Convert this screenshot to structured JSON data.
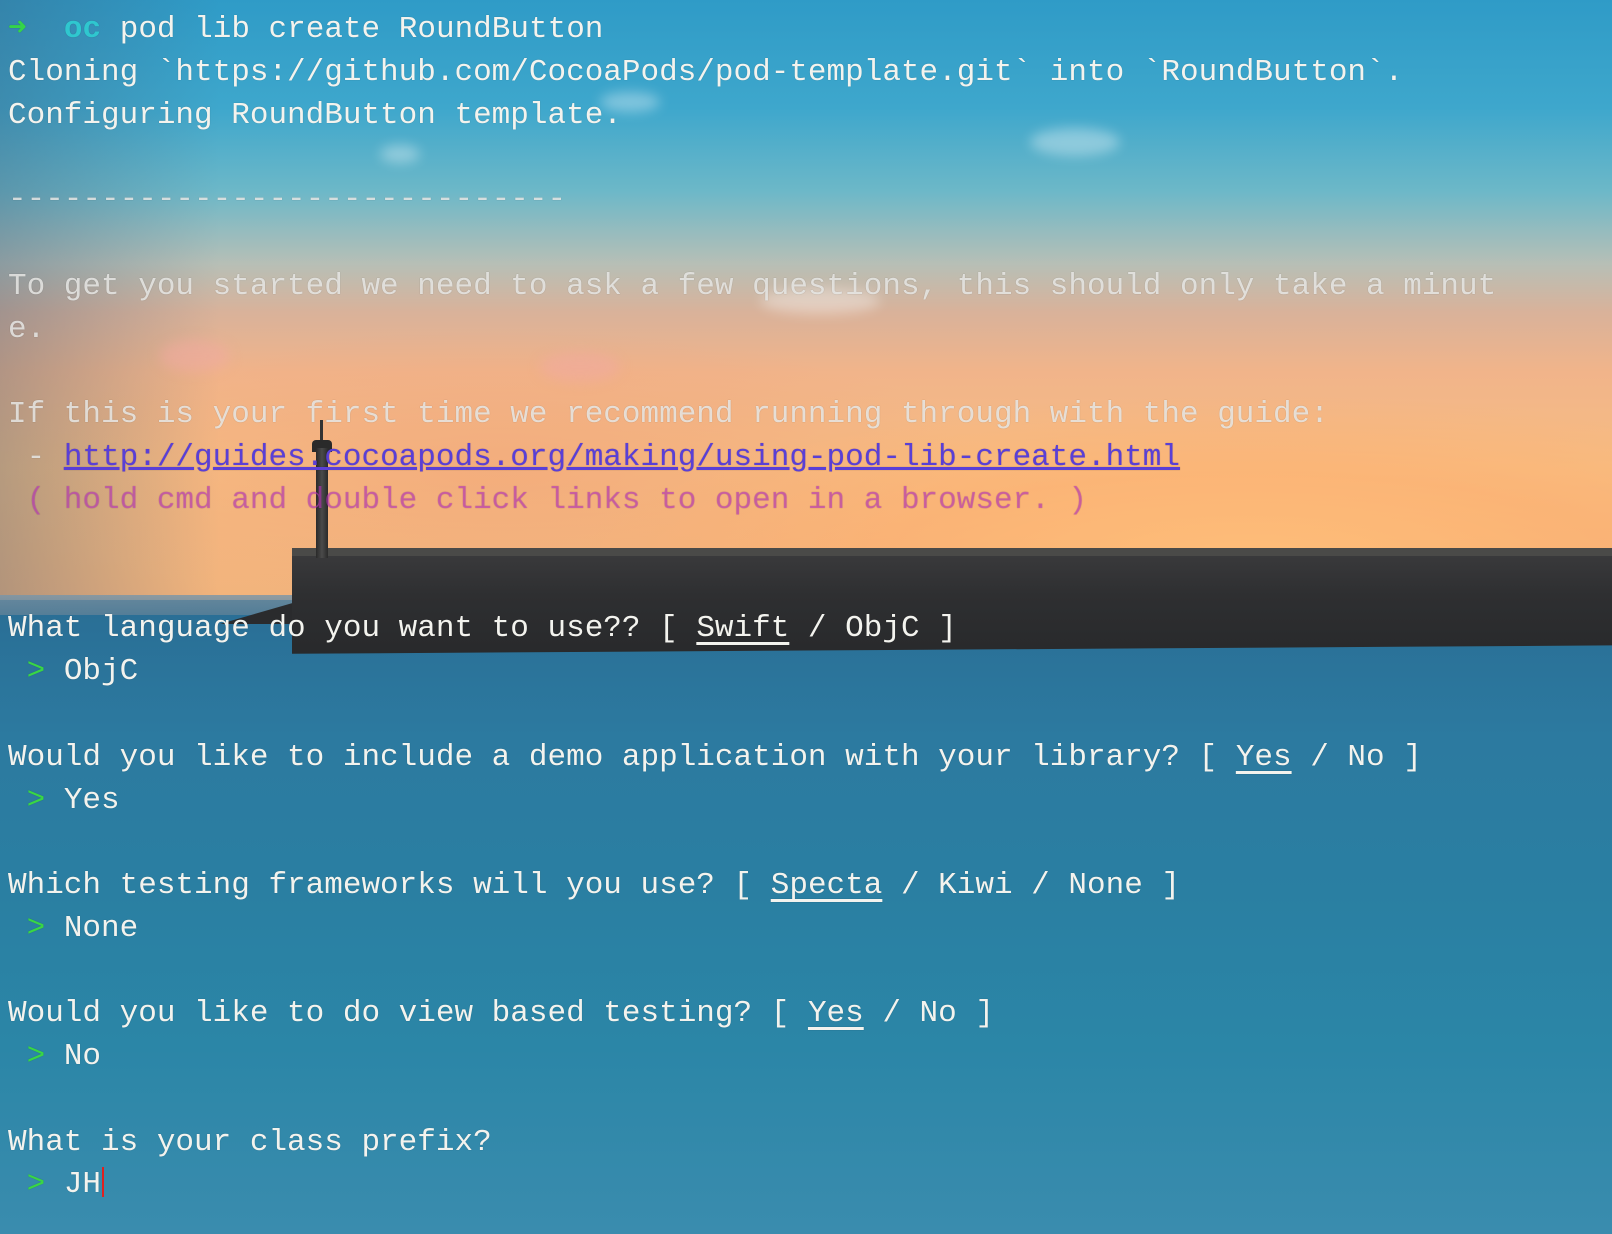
{
  "terminal": {
    "command_line": {
      "arrow": "➜",
      "directory": "oc",
      "command": "pod lib create RoundButton"
    },
    "output": {
      "cloning": "Cloning `https://github.com/CocoaPods/pod-template.git` into `RoundButton`.",
      "configuring": "Configuring RoundButton template.",
      "separator": "------------------------------",
      "intro_part1": "To get you started we need to ask a few questions, this should only take a minut",
      "intro_part2": "e.",
      "guide_line": "If this is your first time we recommend running through with the guide:",
      "guide_bullet": " - ",
      "guide_link": "http://guides.cocoapods.org/making/using-pod-lib-create.html",
      "guide_hint": " ( hold cmd and double click links to open in a browser. )"
    },
    "questions": [
      {
        "prefix": "What language do you want to use?? [ ",
        "default_option": "Swift",
        "suffix": " / ObjC ]",
        "prompt": " > ",
        "answer": "ObjC"
      },
      {
        "prefix": "Would you like to include a demo application with your library? [ ",
        "default_option": "Yes",
        "suffix": " / No ]",
        "prompt": " > ",
        "answer": "Yes"
      },
      {
        "prefix": "Which testing frameworks will you use? [ ",
        "default_option": "Specta",
        "suffix": " / Kiwi / None ]",
        "prompt": " > ",
        "answer": "None"
      },
      {
        "prefix": "Would you like to do view based testing? [ ",
        "default_option": "Yes",
        "suffix": " / No ]",
        "prompt": " > ",
        "answer": "No"
      },
      {
        "prefix": "What is your class prefix?",
        "default_option": "",
        "suffix": "",
        "prompt": " > ",
        "answer": "JH"
      }
    ]
  },
  "colors": {
    "prompt_arrow": "#34d44a",
    "directory": "#2fc7cf",
    "link": "#5a3fd6",
    "hint": "#d23cd2",
    "answer_prompt": "#39d645",
    "cursor": "#e02020",
    "text": "#f3f3ee"
  }
}
